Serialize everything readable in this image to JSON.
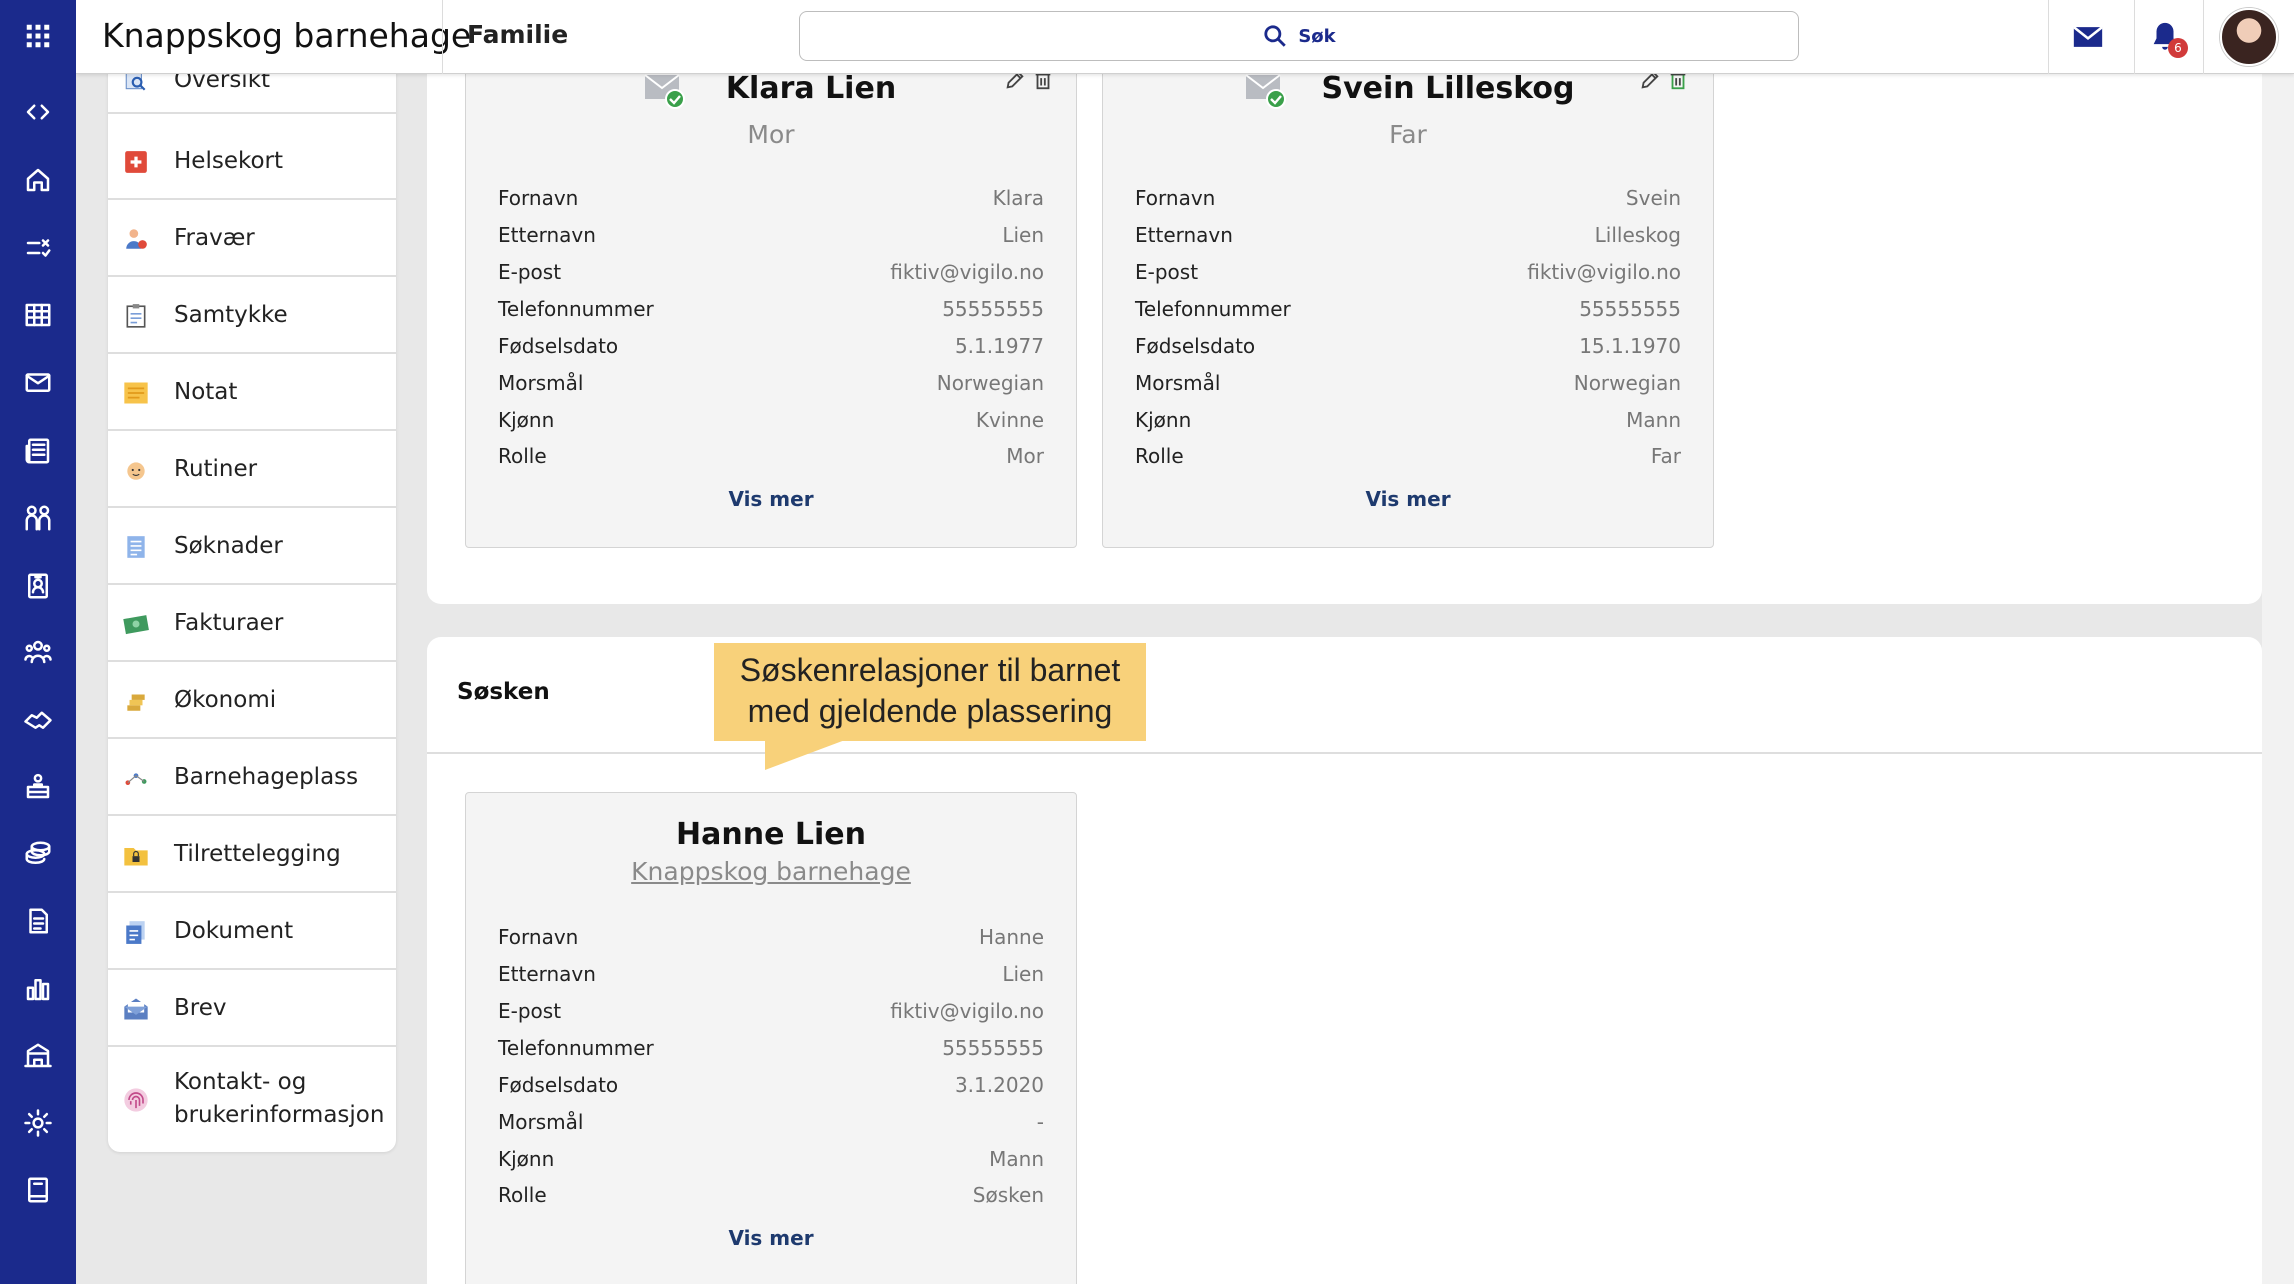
{
  "header": {
    "app_title": "Knappskog barnehage",
    "page_title": "Familie",
    "search_label": "Søk",
    "notification_count": "6"
  },
  "rail_icons": [
    "grid-icon",
    "code-icon",
    "home-icon",
    "checklist-icon",
    "calendar-icon",
    "mail-icon",
    "news-icon",
    "people-icon",
    "badge-icon",
    "group-icon",
    "handshake-icon",
    "child-icon",
    "coins-icon",
    "document-icon",
    "chart-icon",
    "school-icon",
    "gear-icon",
    "book-icon"
  ],
  "sidebar": {
    "items": [
      {
        "label": "Oversikt",
        "icon": "search-doc-icon"
      },
      {
        "label": "Helsekort",
        "icon": "health-card-icon"
      },
      {
        "label": "Fravær",
        "icon": "absence-icon"
      },
      {
        "label": "Samtykke",
        "icon": "consent-icon"
      },
      {
        "label": "Notat",
        "icon": "note-icon"
      },
      {
        "label": "Rutiner",
        "icon": "routine-icon"
      },
      {
        "label": "Søknader",
        "icon": "application-icon"
      },
      {
        "label": "Fakturaer",
        "icon": "invoice-icon"
      },
      {
        "label": "Økonomi",
        "icon": "coins-icon"
      },
      {
        "label": "Barnehageplass",
        "icon": "placement-icon"
      },
      {
        "label": "Tilrettelegging",
        "icon": "folder-lock-icon"
      },
      {
        "label": "Dokument",
        "icon": "document-icon"
      },
      {
        "label": "Brev",
        "icon": "letter-icon"
      },
      {
        "label": "Kontakt- og brukerinformasjon",
        "label_line1": "Kontakt- og",
        "label_line2": "brukerinformasjon",
        "icon": "fingerprint-icon"
      }
    ]
  },
  "parents": [
    {
      "name": "Klara Lien",
      "role": "Mor",
      "fields": [
        {
          "k": "Fornavn",
          "v": "Klara"
        },
        {
          "k": "Etternavn",
          "v": "Lien"
        },
        {
          "k": "E-post",
          "v": "fiktiv@vigilo.no"
        },
        {
          "k": "Telefonnummer",
          "v": "55555555"
        },
        {
          "k": "Fødselsdato",
          "v": "5.1.1977"
        },
        {
          "k": "Morsmål",
          "v": "Norwegian"
        },
        {
          "k": "Kjønn",
          "v": "Kvinne"
        },
        {
          "k": "Rolle",
          "v": "Mor"
        }
      ],
      "more": "Vis mer"
    },
    {
      "name": "Svein Lilleskog",
      "role": "Far",
      "fields": [
        {
          "k": "Fornavn",
          "v": "Svein"
        },
        {
          "k": "Etternavn",
          "v": "Lilleskog"
        },
        {
          "k": "E-post",
          "v": "fiktiv@vigilo.no"
        },
        {
          "k": "Telefonnummer",
          "v": "55555555"
        },
        {
          "k": "Fødselsdato",
          "v": "15.1.1970"
        },
        {
          "k": "Morsmål",
          "v": "Norwegian"
        },
        {
          "k": "Kjønn",
          "v": "Mann"
        },
        {
          "k": "Rolle",
          "v": "Far"
        }
      ],
      "more": "Vis mer"
    }
  ],
  "siblings_section": {
    "title": "Søsken",
    "callout_line1": "Søskenrelasjoner til barnet",
    "callout_line2": "med gjeldende plassering"
  },
  "sibling": {
    "name": "Hanne Lien",
    "placement": "Knappskog barnehage",
    "fields": [
      {
        "k": "Fornavn",
        "v": "Hanne"
      },
      {
        "k": "Etternavn",
        "v": "Lien"
      },
      {
        "k": "E-post",
        "v": "fiktiv@vigilo.no"
      },
      {
        "k": "Telefonnummer",
        "v": "55555555"
      },
      {
        "k": "Fødselsdato",
        "v": "3.1.2020"
      },
      {
        "k": "Morsmål",
        "v": "-"
      },
      {
        "k": "Kjønn",
        "v": "Mann"
      },
      {
        "k": "Rolle",
        "v": "Søsken"
      }
    ],
    "more": "Vis mer"
  },
  "colors": {
    "rail": "#1b2a8c",
    "accent_link": "#1e3a6e",
    "callout": "#f8d17a",
    "badge": "#d13a3a"
  }
}
